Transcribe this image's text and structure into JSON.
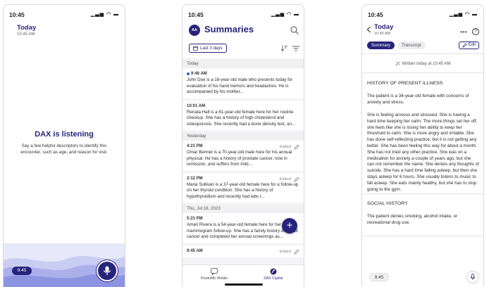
{
  "status": {
    "time": "10:45",
    "icons": "▁▃▅ ◠ ▬"
  },
  "recorder": {
    "title": "Today",
    "subtitle": "10:45 AM",
    "listening_title": "DAX is listening",
    "listening_hint": "Say a few helpful descriptors to identify this encounter, such as age, and reason for visit.",
    "timer": "9:45"
  },
  "summaries": {
    "avatar": "AA",
    "title": "Summaries",
    "date_filter": "Last 3 days",
    "groups": [
      {
        "label": "Today",
        "items": [
          {
            "time": "9:46 AM",
            "unread": true,
            "edited": "",
            "text": "John Doe is a 16-year-old male who presents today for evaluation of his hand tremors and headaches. He is accompanied by his mother..."
          },
          {
            "time": "10:01 AM",
            "unread": false,
            "edited": "",
            "text": "Renata Hall is a 61-year-old female here for her routine checkup. She has a history of high cholesterol and osteoporosis. She recently had a bone density test, an..."
          }
        ]
      },
      {
        "label": "Yesterday",
        "items": [
          {
            "time": "4:21 PM",
            "unread": false,
            "edited": "Edited",
            "text": "Omar Bennet is a 70-year-old male here for his annual physical. He has a history of prostate cancer, now in remission, and suffers from mild..."
          },
          {
            "time": "2:12 PM",
            "unread": false,
            "edited": "Edited",
            "text": "Maria Sullivan is a 37-year-old female here for a follow-up on her thyroid condition. She has a history of hypothyroidism and recently had labs t..."
          }
        ]
      },
      {
        "label": "Thu, Jul 18, 2023",
        "items": [
          {
            "time": "5:21 PM",
            "unread": false,
            "edited": "",
            "text": "Amari Rivera is a 54-year-old female here for her mammogram follow-up. She has a family history of breast cancer and completed her annual screenings as..."
          },
          {
            "time": "9:45 AM",
            "unread": false,
            "edited": "Edited",
            "text": ""
          }
        ]
      }
    ],
    "nav": [
      {
        "label": "PowerMic Mobile",
        "icon": "chat-bubble-icon"
      },
      {
        "label": "DAX Copilot",
        "icon": "dax-logo-icon"
      }
    ]
  },
  "detail": {
    "title": "Today",
    "subtitle": "10:45 AM",
    "tabs": [
      "Summary",
      "Transcript"
    ],
    "edit_label": "Edit",
    "written_note": "Written today at 10:45 AM",
    "sections": [
      {
        "heading": "HISTORY OF PRESENT ILLNESS",
        "paragraphs": [
          "The patient is a 34-year-old female with concerns of anxiety and stress.",
          "She is feeling anxious and stressed. She is having a hard time keeping her calm. The more things set her off, she feels like she is losing her ability to keep her threshold to calm. She is more angry and irritable. She has done self-reflecting practice, but it is not getting any better. She has been feeling this way for about a month. She has not tried any other practice. She was on a medication for anxiety a couple of years ago, but she can not remember the name. She denies any thoughts of suicide. She has a hard time falling asleep, but then she stays asleep for 6 hours. She usually listens to music to fall asleep. She eats mainly healthy, but she has to stop going to the gym."
        ]
      },
      {
        "heading": "SOCIAL HISTORY",
        "paragraphs": [
          "The patient denies smoking, alcohol intake, or recreational drug use."
        ]
      }
    ],
    "timer": "9:45"
  },
  "colors": {
    "brand": "#26247b",
    "unread_dot": "#1f6fd6",
    "wave_light": "#c9cdf2"
  }
}
